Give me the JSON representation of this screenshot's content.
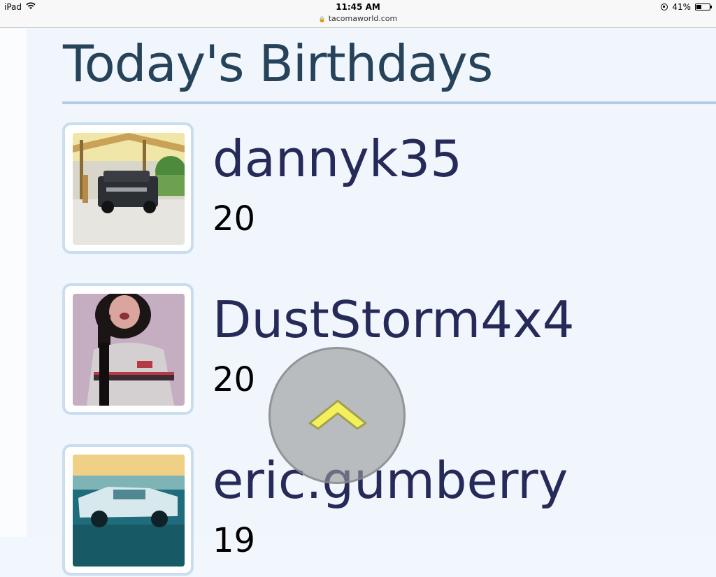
{
  "status_bar": {
    "device": "iPad",
    "time": "11:45 AM",
    "url": "tacomaworld.com",
    "battery_percent": "41%",
    "battery_level": 0.41
  },
  "page": {
    "title": "Today's Birthdays"
  },
  "members": [
    {
      "name": "dannyk35",
      "age": "20"
    },
    {
      "name": "DustStorm4x4",
      "age": "20"
    },
    {
      "name": "eric.gumberry",
      "age": "19"
    }
  ],
  "icons": {
    "wifi": "wifi-icon",
    "lock": "lock-icon",
    "rotation_lock": "rotation-lock-icon",
    "battery": "battery-icon",
    "scroll_top": "chevron-up-icon"
  },
  "colors": {
    "title": "#26435a",
    "member_name": "#252a59",
    "rule": "#b4cde6",
    "scroll_chevron": "#f4f05a"
  }
}
